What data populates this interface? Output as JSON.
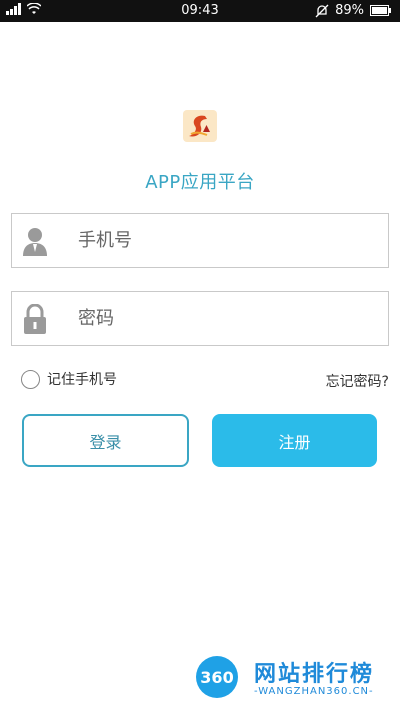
{
  "status_bar": {
    "time": "09:43",
    "battery": "89%",
    "icons": [
      "signal-icon",
      "wifi-icon",
      "alarm-off-icon",
      "battery-icon"
    ]
  },
  "app": {
    "title": "APP应用平台",
    "logo": "app-logo-icon",
    "accent_color": "#3aa6c4",
    "primary_color": "#2bbbe9"
  },
  "form": {
    "phone_placeholder": "手机号",
    "password_placeholder": "密码",
    "remember_label": "记住手机号",
    "forgot_label": "忘记密码?",
    "login_label": "登录",
    "register_label": "注册"
  },
  "watermark": {
    "circle_text": "360",
    "text": "网站排行榜",
    "sub": "-WANGZHAN360.CN-"
  }
}
